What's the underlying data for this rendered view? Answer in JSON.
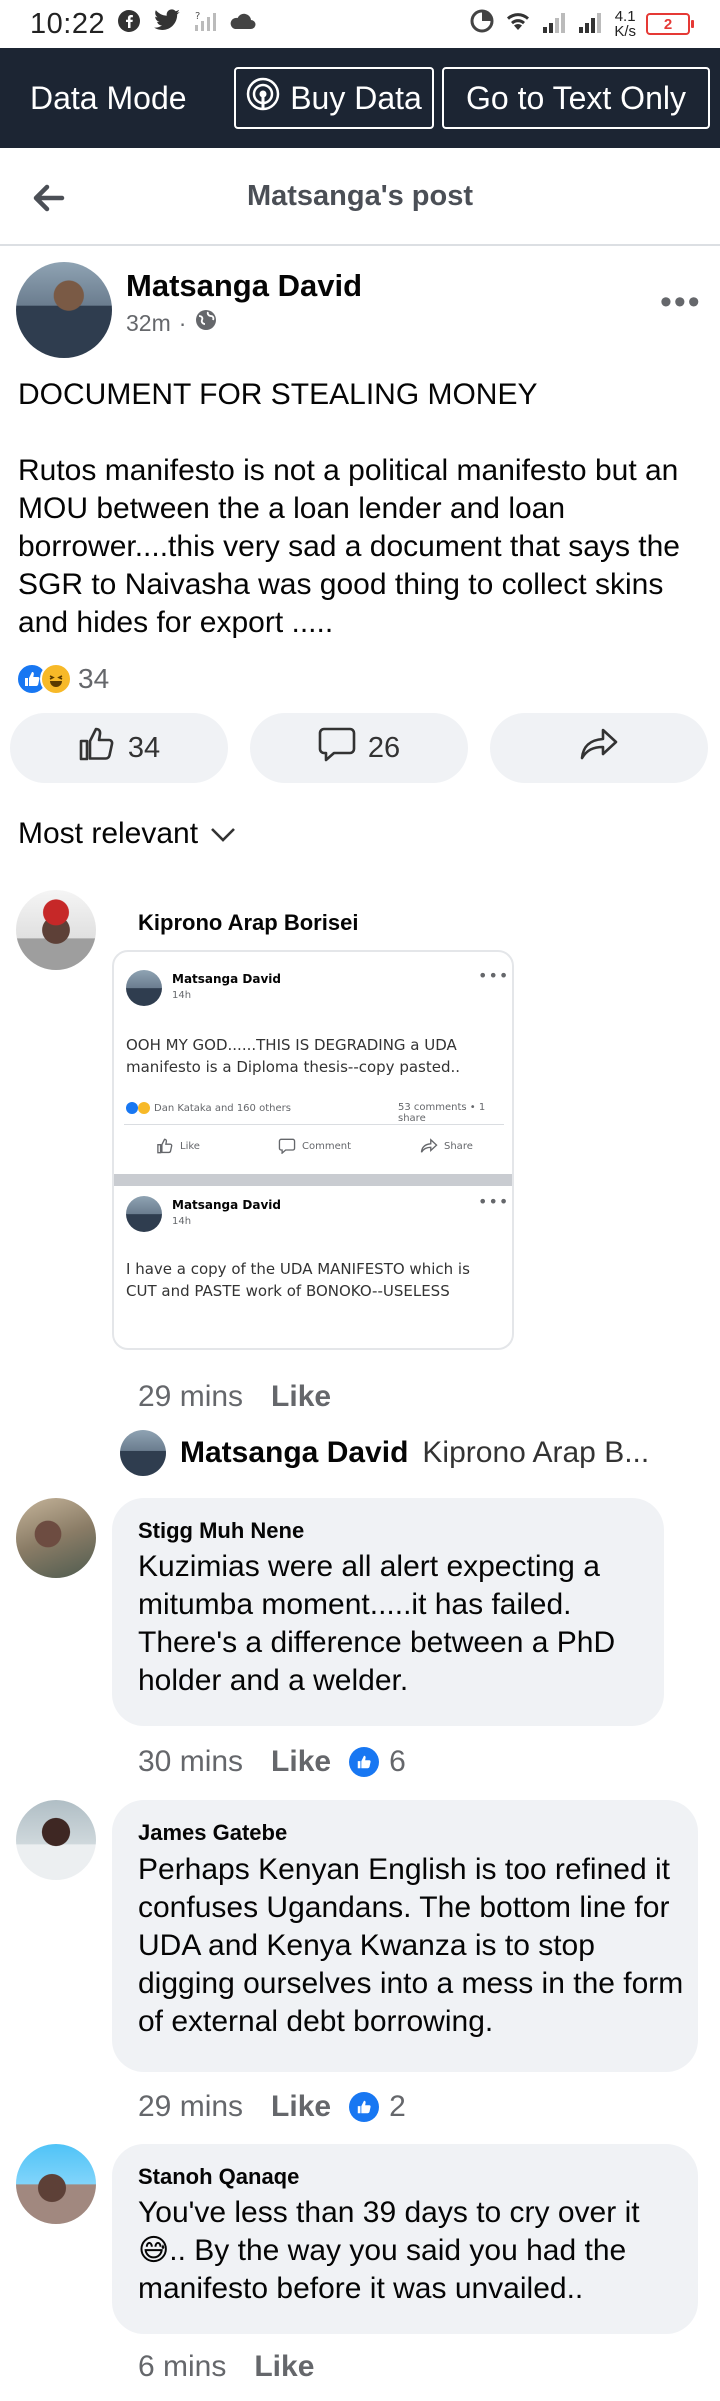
{
  "status_bar": {
    "time": "10:22",
    "net_speed_top": "4.1",
    "net_speed_bottom": "K/s",
    "battery": "2"
  },
  "data_bar": {
    "mode_label": "Data Mode",
    "buy_label": "Buy Data",
    "text_only_label": "Go to Text Only"
  },
  "header": {
    "title": "Matsanga's post"
  },
  "post": {
    "author": "Matsanga David",
    "time": "32m",
    "text": "DOCUMENT FOR STEALING MONEY\n\nRutos manifesto is not a political manifesto but an MOU between the a loan lender and loan borrower....this very sad a document that says the SGR to Naivasha was good thing to collect skins and hides for export .....",
    "reaction_count": "34",
    "like_count": "34",
    "comment_count": "26"
  },
  "sort": {
    "label": "Most relevant"
  },
  "comments": [
    {
      "name": "Kiprono Arap Borisei",
      "time": "29 mins",
      "like_label": "Like",
      "attachment": {
        "post1_author": "Matsanga David",
        "post1_time": "14h",
        "post1_text": "OOH MY GOD......THIS IS DEGRADING a UDA manifesto is a Diploma thesis--copy pasted..",
        "post1_reactions": "Dan Kataka and 160 others",
        "post1_stats": "53 comments • 1 share",
        "like": "Like",
        "comment": "Comment",
        "share": "Share",
        "post2_author": "Matsanga David",
        "post2_time": "14h",
        "post2_text": "I have a copy of the UDA MANIFESTO  which is CUT and PASTE work of BONOKO--USELESS"
      },
      "reply_preview": {
        "name": "Matsanga David",
        "text": "Kiprono Arap B..."
      }
    },
    {
      "name": "Stigg Muh Nene",
      "text": "Kuzimias were all alert expecting a mitumba moment.....it has failed. There's a difference between a PhD holder and a welder.",
      "time": "30 mins",
      "like_label": "Like",
      "likes": "6"
    },
    {
      "name": "James Gatebe",
      "text": "Perhaps Kenyan English is too refined it confuses Ugandans. The bottom line for UDA and Kenya Kwanza is to stop digging ourselves into a mess in the form of external debt borrowing.",
      "time": "29 mins",
      "like_label": "Like",
      "likes": "2"
    },
    {
      "name": "Stanoh Qanaqe",
      "text": "You've less than 39 days to cry over it😅.. By the way you said you had the manifesto before it was unvailed..",
      "time": "6 mins",
      "like_label": "Like"
    }
  ],
  "colors": {
    "accent": "#1877f2",
    "data_bar": "#1c2533",
    "bubble": "#f0f2f5",
    "secondary_text": "#65676b"
  }
}
